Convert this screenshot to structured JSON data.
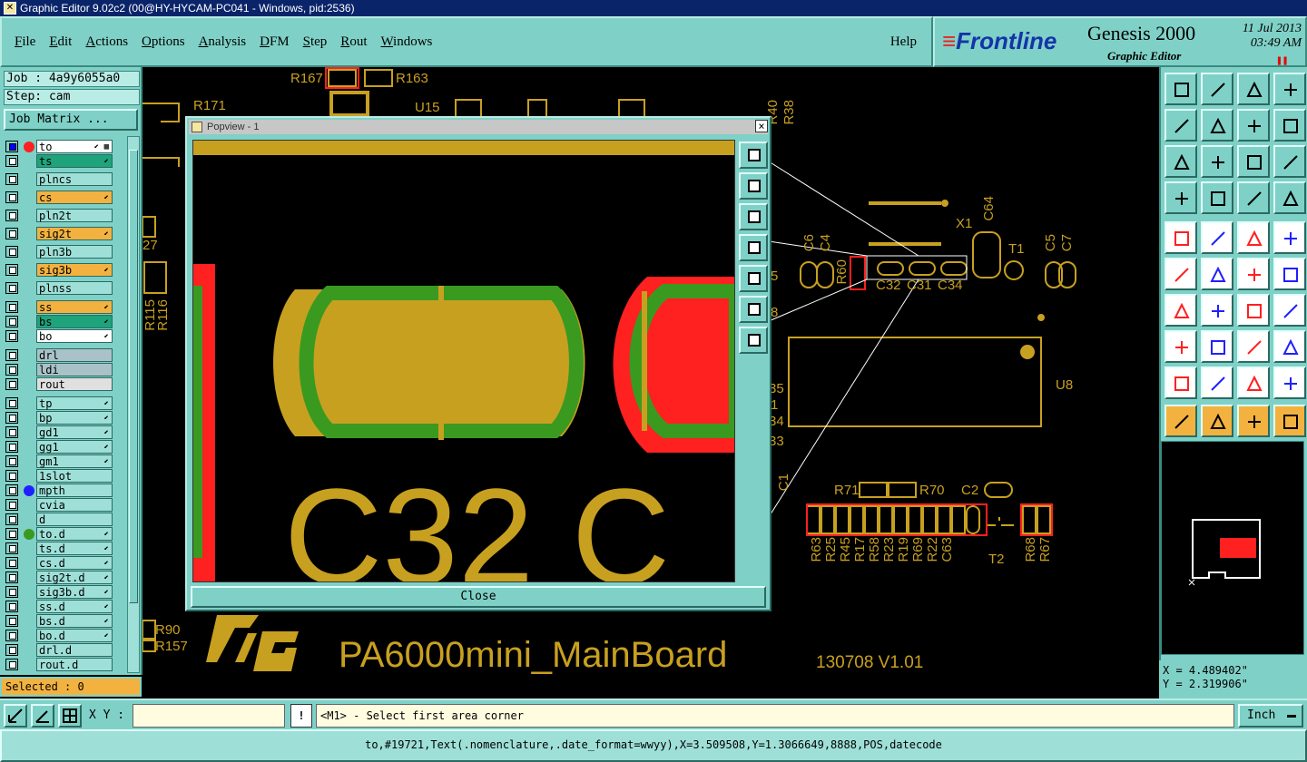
{
  "window": {
    "title": "Graphic Editor 9.02c2 (00@HY-HYCAM-PC041 - Windows, pid:2536)"
  },
  "menu": {
    "items": [
      "File",
      "Edit",
      "Actions",
      "Options",
      "Analysis",
      "DFM",
      "Step",
      "Rout",
      "Windows"
    ],
    "help": "Help"
  },
  "logo": {
    "brand": "Frontline",
    "product": "Genesis 2000",
    "subtitle": "Graphic Editor",
    "date": "11 Jul 2013",
    "time": "03:49 AM"
  },
  "job": {
    "job_line": "Job : 4a9y6055a0",
    "step_line": "Step: cam",
    "matrix_button": "Job Matrix ..."
  },
  "layers": [
    {
      "name": "to",
      "color": "#ffffff",
      "dot": "#ff2020",
      "checked": true,
      "mark": "⬋ ▦"
    },
    {
      "name": "ts",
      "color": "#1fa37a",
      "dot": "",
      "checked": false,
      "mark": "⬋"
    },
    {
      "name": "plncs",
      "color": "#9ee0d8",
      "dot": "",
      "checked": false,
      "mark": ""
    },
    {
      "name": "cs",
      "color": "#f3b23f",
      "dot": "",
      "checked": false,
      "mark": "⬋"
    },
    {
      "name": "pln2t",
      "color": "#9ee0d8",
      "dot": "",
      "checked": false,
      "mark": ""
    },
    {
      "name": "sig2t",
      "color": "#f3b23f",
      "dot": "",
      "checked": false,
      "mark": "⬋"
    },
    {
      "name": "pln3b",
      "color": "#9ee0d8",
      "dot": "",
      "checked": false,
      "mark": ""
    },
    {
      "name": "sig3b",
      "color": "#f3b23f",
      "dot": "",
      "checked": false,
      "mark": "⬋"
    },
    {
      "name": "plnss",
      "color": "#9ee0d8",
      "dot": "",
      "checked": false,
      "mark": ""
    },
    {
      "name": "ss",
      "color": "#f3b23f",
      "dot": "",
      "checked": false,
      "mark": "⬋"
    },
    {
      "name": "bs",
      "color": "#1fa37a",
      "dot": "",
      "checked": false,
      "mark": "⬋"
    },
    {
      "name": "bo",
      "color": "#ffffff",
      "dot": "",
      "checked": false,
      "mark": "⬋"
    },
    {
      "name": "drl",
      "color": "#a9c2c8",
      "dot": "",
      "checked": false,
      "mark": ""
    },
    {
      "name": "ldi",
      "color": "#a9c2c8",
      "dot": "",
      "checked": false,
      "mark": ""
    },
    {
      "name": "rout",
      "color": "#e0e0e0",
      "dot": "",
      "checked": false,
      "mark": ""
    },
    {
      "name": "tp",
      "color": "#9ee0d8",
      "dot": "",
      "checked": false,
      "mark": "⬋"
    },
    {
      "name": "bp",
      "color": "#9ee0d8",
      "dot": "",
      "checked": false,
      "mark": "⬋"
    },
    {
      "name": "gd1",
      "color": "#9ee0d8",
      "dot": "",
      "checked": false,
      "mark": "⬋"
    },
    {
      "name": "gg1",
      "color": "#9ee0d8",
      "dot": "",
      "checked": false,
      "mark": "⬋"
    },
    {
      "name": "gm1",
      "color": "#9ee0d8",
      "dot": "",
      "checked": false,
      "mark": "⬋"
    },
    {
      "name": "1slot",
      "color": "#9ee0d8",
      "dot": "",
      "checked": false,
      "mark": ""
    },
    {
      "name": "mpth",
      "color": "#9ee0d8",
      "dot": "#2020ff",
      "checked": false,
      "mark": ""
    },
    {
      "name": "cvia",
      "color": "#9ee0d8",
      "dot": "",
      "checked": false,
      "mark": ""
    },
    {
      "name": "d",
      "color": "#9ee0d8",
      "dot": "",
      "checked": false,
      "mark": ""
    },
    {
      "name": "to.d",
      "color": "#9ee0d8",
      "dot": "#3a9a20",
      "checked": false,
      "mark": "⬋"
    },
    {
      "name": "ts.d",
      "color": "#9ee0d8",
      "dot": "",
      "checked": false,
      "mark": "⬋"
    },
    {
      "name": "cs.d",
      "color": "#9ee0d8",
      "dot": "",
      "checked": false,
      "mark": "⬋"
    },
    {
      "name": "sig2t.d",
      "color": "#9ee0d8",
      "dot": "",
      "checked": false,
      "mark": "⬋"
    },
    {
      "name": "sig3b.d",
      "color": "#9ee0d8",
      "dot": "",
      "checked": false,
      "mark": "⬋"
    },
    {
      "name": "ss.d",
      "color": "#9ee0d8",
      "dot": "",
      "checked": false,
      "mark": "⬋"
    },
    {
      "name": "bs.d",
      "color": "#9ee0d8",
      "dot": "",
      "checked": false,
      "mark": "⬋"
    },
    {
      "name": "bo.d",
      "color": "#9ee0d8",
      "dot": "",
      "checked": false,
      "mark": "⬋"
    },
    {
      "name": "drl.d",
      "color": "#9ee0d8",
      "dot": "",
      "checked": false,
      "mark": ""
    },
    {
      "name": "rout.d",
      "color": "#9ee0d8",
      "dot": "",
      "checked": false,
      "mark": ""
    }
  ],
  "selected": "Selected : 0",
  "popview": {
    "title": "Popview - 1",
    "close_label": "Close",
    "close_x": "×",
    "zoom_text": "C32 C"
  },
  "board": {
    "title": "PA6000mini_MainBoard",
    "version": "130708  V1.01",
    "refdes_top": [
      "R167",
      "R163",
      "R171",
      "U15",
      "R40",
      "R38"
    ],
    "refdes_mid": [
      "C64",
      "X1",
      "T1",
      "C5",
      "C7",
      "C6",
      "C4",
      "R60",
      "C32",
      "C31",
      "C34",
      "U8"
    ],
    "refdes_low": [
      "R71",
      "R70",
      "C2",
      "C1",
      "T2"
    ],
    "refdes_vertical": [
      "R63",
      "R25",
      "R45",
      "R17",
      "R58",
      "R23",
      "R19",
      "R69",
      "R22",
      "C63",
      "R68",
      "R67"
    ],
    "refdes_left": [
      "27",
      "R115",
      "R116",
      "5",
      "8",
      "35",
      "1",
      "34",
      "33",
      "R90",
      "R157"
    ]
  },
  "coords": {
    "x": "X = 4.489402\"",
    "y": "Y = 2.319906\""
  },
  "command": {
    "xy_label": "X Y :",
    "xy_value": "",
    "warn": "!",
    "prompt": "<M1> - Select first area corner",
    "units": "Inch"
  },
  "status": "to,#19721,Text(.nomenclature,.date_format=wwyy),X=3.509508,Y=1.3066649,8888,POS,datecode",
  "colors": {
    "panel": "#7fd1c7",
    "silk": "#c8a020",
    "copper_green": "#3a9a20",
    "red": "#ff2020"
  }
}
